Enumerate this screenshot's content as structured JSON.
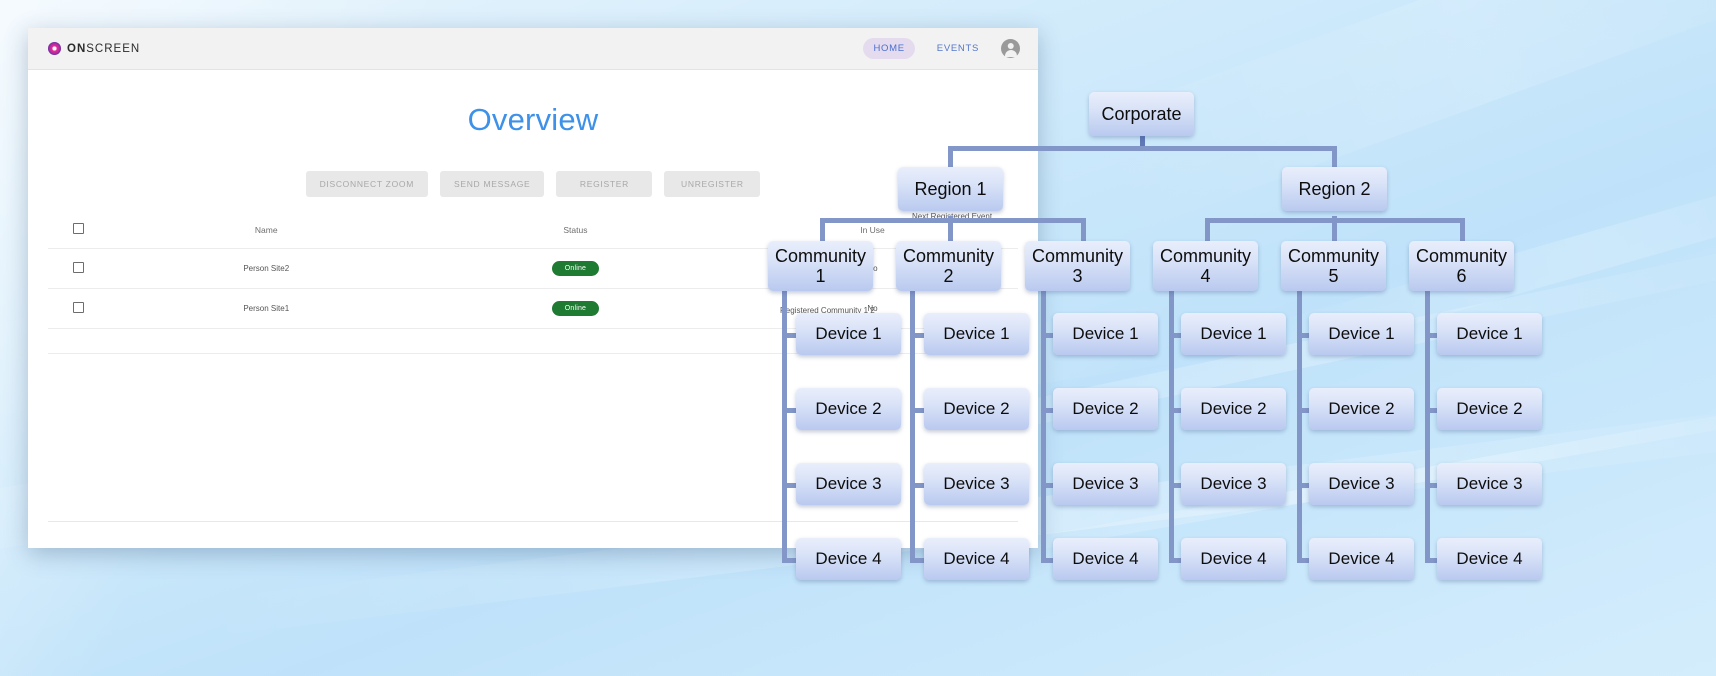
{
  "window": {
    "brand": {
      "bold_part": "ON",
      "rest": "SCREEN",
      "full": "ONSCREEN",
      "icon": "onscreen-logo-icon"
    },
    "nav": [
      {
        "label": "HOME",
        "active": true
      },
      {
        "label": "EVENTS",
        "active": false
      }
    ],
    "avatar_icon": "user-avatar-icon",
    "page_title": "Overview"
  },
  "toolbar": {
    "buttons": [
      {
        "label": "DISCONNECT ZOOM"
      },
      {
        "label": "SEND MESSAGE"
      },
      {
        "label": "REGISTER"
      },
      {
        "label": "UNREGISTER"
      }
    ]
  },
  "table": {
    "columns": [
      "",
      "Name",
      "Status",
      "In Use"
    ],
    "rows": [
      {
        "checked": false,
        "name": "Person Site2",
        "status": "Online",
        "in_use": "No"
      },
      {
        "checked": false,
        "name": "Person Site1",
        "status": "Online",
        "in_use": "No"
      }
    ]
  },
  "overlay_labels": {
    "next_event": "Next Registered Event",
    "registered_row": "Registered Community 1 2"
  },
  "colors": {
    "accent_title": "#3d91e8",
    "status_online": "#1f7a32",
    "node_fill_top": "#e9eefb",
    "node_fill_bottom": "#b9c9ef",
    "connector": "#8296c8",
    "nav_active_pill": "#e4dcee",
    "desktop_background": "#bfe2fa"
  },
  "org_chart": {
    "root": {
      "label": "Corporate"
    },
    "regions": [
      {
        "label": "Region 1"
      },
      {
        "label": "Region 2"
      }
    ],
    "communities": [
      {
        "label": "Community 1"
      },
      {
        "label": "Community 2"
      },
      {
        "label": "Community 3"
      },
      {
        "label": "Community 4"
      },
      {
        "label": "Community 5"
      },
      {
        "label": "Community 6"
      }
    ],
    "devices": [
      {
        "label": "Device 1"
      },
      {
        "label": "Device 2"
      },
      {
        "label": "Device 3"
      },
      {
        "label": "Device 4"
      }
    ]
  }
}
